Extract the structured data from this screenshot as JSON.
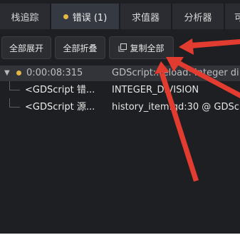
{
  "tabs": [
    {
      "label": "栈追踪"
    },
    {
      "label": "错误 (1)"
    },
    {
      "label": "求值器"
    },
    {
      "label": "分析器"
    },
    {
      "label": "可"
    }
  ],
  "toolbar": {
    "expand_all_label": "全部展开",
    "collapse_all_label": "全部折叠",
    "copy_all_label": "复制全部"
  },
  "errors": {
    "entry": {
      "time": "0:00:08:315",
      "message": "GDScript::reload: Integer di"
    },
    "children": [
      {
        "key": "<GDScript 错...",
        "value": "INTEGER_DIVISION"
      },
      {
        "key": "<GDScript 源...",
        "value": "history_item.gd:30 @ GDSc"
      }
    ]
  },
  "colors": {
    "warning": "#e3b647",
    "annotation_arrow": "#e23b2f",
    "panel_bg": "#1e1f22"
  },
  "icons": {
    "copy": "copy-icon",
    "expand_toggle": "chevron-down-icon",
    "severity": "warning-dot-icon"
  }
}
